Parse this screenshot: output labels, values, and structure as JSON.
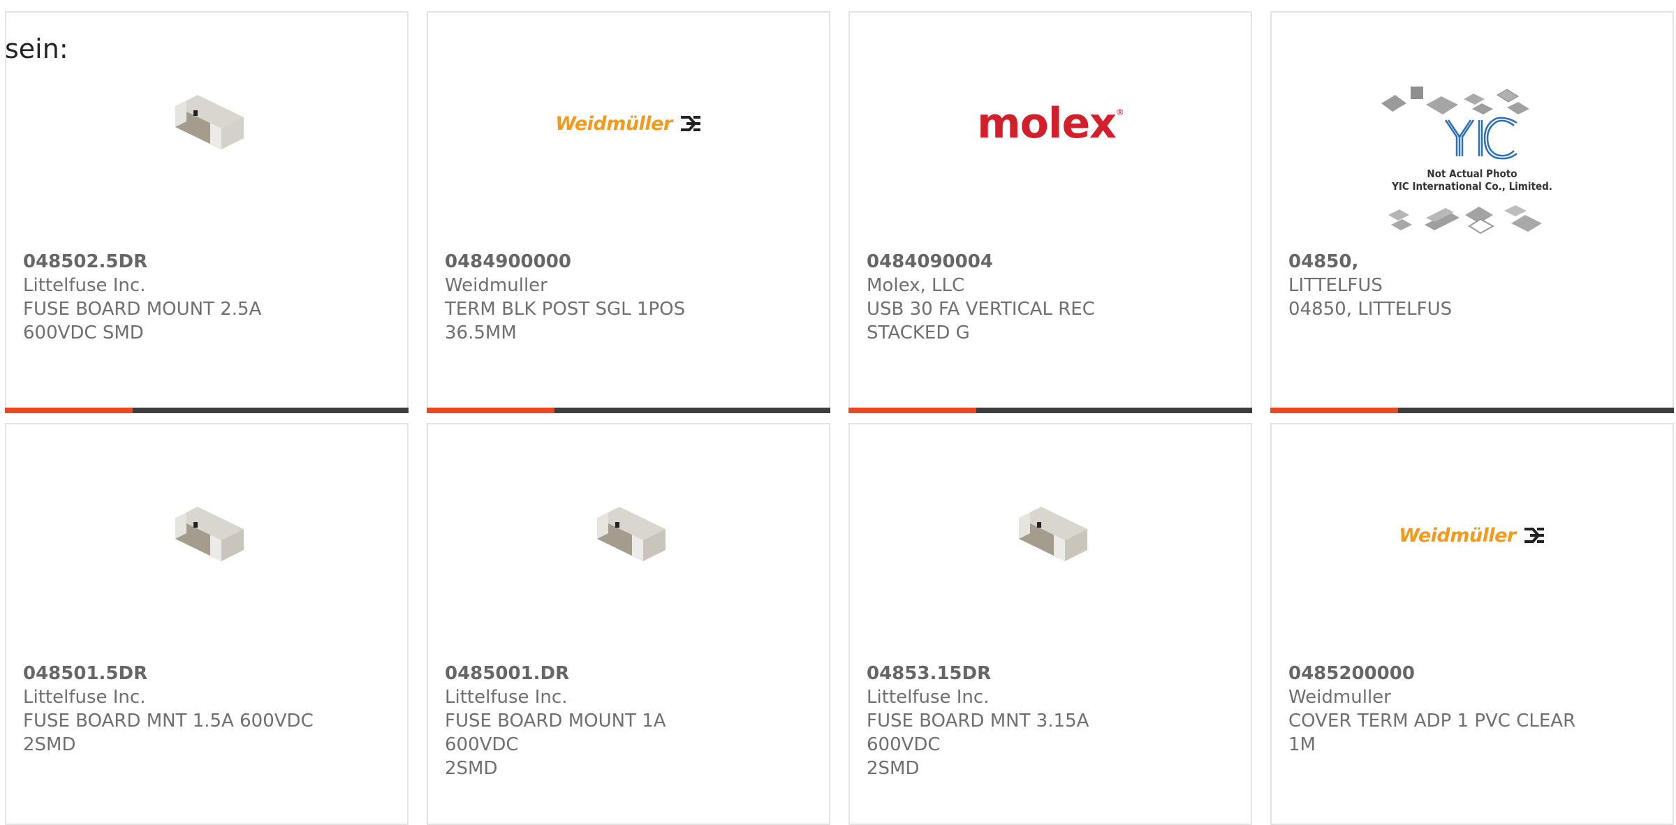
{
  "prefix_text": "sein:",
  "colors": {
    "accent": "#ee4623",
    "bar": "#3d3d3d",
    "weidmuller": "#f39a1d",
    "molex": "#d21f2b",
    "yic": "#2a6fb7"
  },
  "products": [
    {
      "part": "048502.5DR",
      "manufacturer": "Littelfuse Inc.",
      "desc1": "FUSE BOARD MOUNT 2.5A",
      "desc2": "600VDC SMD",
      "image": "fuse-chip-icon"
    },
    {
      "part": "0484900000",
      "manufacturer": "Weidmuller",
      "desc1": "TERM BLK POST SGL 1POS",
      "desc2": "36.5MM",
      "image": "weidmuller-logo",
      "logo_text": "Weidmüller"
    },
    {
      "part": "0484090004",
      "manufacturer": "Molex, LLC",
      "desc1": "USB 30 FA VERTICAL REC",
      "desc2": "STACKED G",
      "image": "molex-logo",
      "logo_text": "molex"
    },
    {
      "part": "04850,",
      "manufacturer": "LITTELFUS",
      "desc1": "04850, LITTELFUS",
      "desc2": "",
      "image": "yic-placeholder",
      "logo_line1": "Not Actual Photo",
      "logo_line2": "YIC International Co., Limited."
    },
    {
      "part": "048501.5DR",
      "manufacturer": "Littelfuse Inc.",
      "desc1": "FUSE BOARD MNT 1.5A 600VDC",
      "desc2": "2SMD",
      "image": "fuse-chip-icon"
    },
    {
      "part": "0485001.DR",
      "manufacturer": "Littelfuse Inc.",
      "desc1": "FUSE BOARD MOUNT 1A 600VDC",
      "desc2": "2SMD",
      "image": "fuse-chip-icon"
    },
    {
      "part": "04853.15DR",
      "manufacturer": "Littelfuse Inc.",
      "desc1": "FUSE BOARD MNT 3.15A 600VDC",
      "desc2": "2SMD",
      "image": "fuse-chip-icon"
    },
    {
      "part": "0485200000",
      "manufacturer": "Weidmuller",
      "desc1": "COVER TERM ADP 1 PVC CLEAR",
      "desc2": "1M",
      "image": "weidmuller-logo",
      "logo_text": "Weidmüller"
    }
  ]
}
